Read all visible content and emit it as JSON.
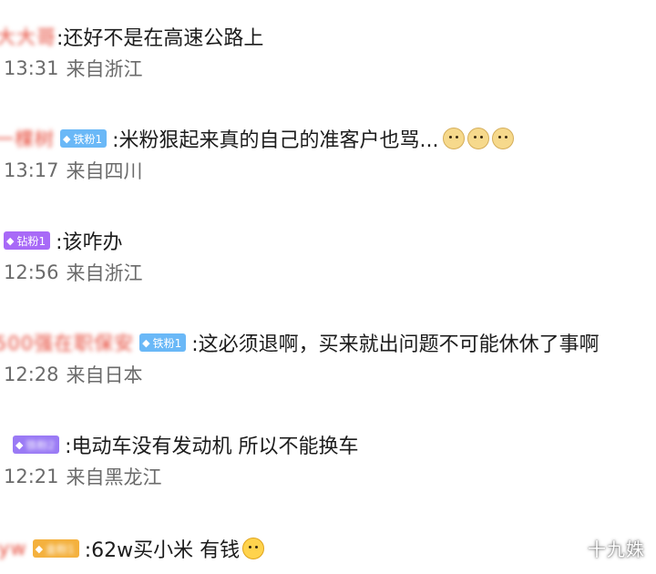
{
  "comments": [
    {
      "username": "大大哥",
      "badge": null,
      "text": ":还好不是在高速公路上",
      "time": "13:31",
      "location": "来自浙江"
    },
    {
      "username": "一棵树",
      "badge": "铁粉1",
      "text": ":米粉狠起来真的自己的准客户也骂...",
      "time": "13:17",
      "location": "来自四川"
    },
    {
      "username": "",
      "badge": "钻粉1",
      "text": ":该咋办",
      "time": "12:56",
      "location": "来自浙江"
    },
    {
      "username": "500强在职保安",
      "badge": "铁粉1",
      "text": ":这必须退啊，买来就出问题不可能休休了事啊",
      "time": "12:28",
      "location": "来自日本"
    },
    {
      "username": "",
      "badge": "铁粉2",
      "text": ":电动车没有发动机  所以不能换车",
      "time": "12:21",
      "location": "来自黑龙江"
    },
    {
      "username": "yw",
      "badge": "金粉1",
      "text": ":62w买小米  有钱",
      "time": "",
      "location": ""
    }
  ],
  "watermark": "十九姝"
}
